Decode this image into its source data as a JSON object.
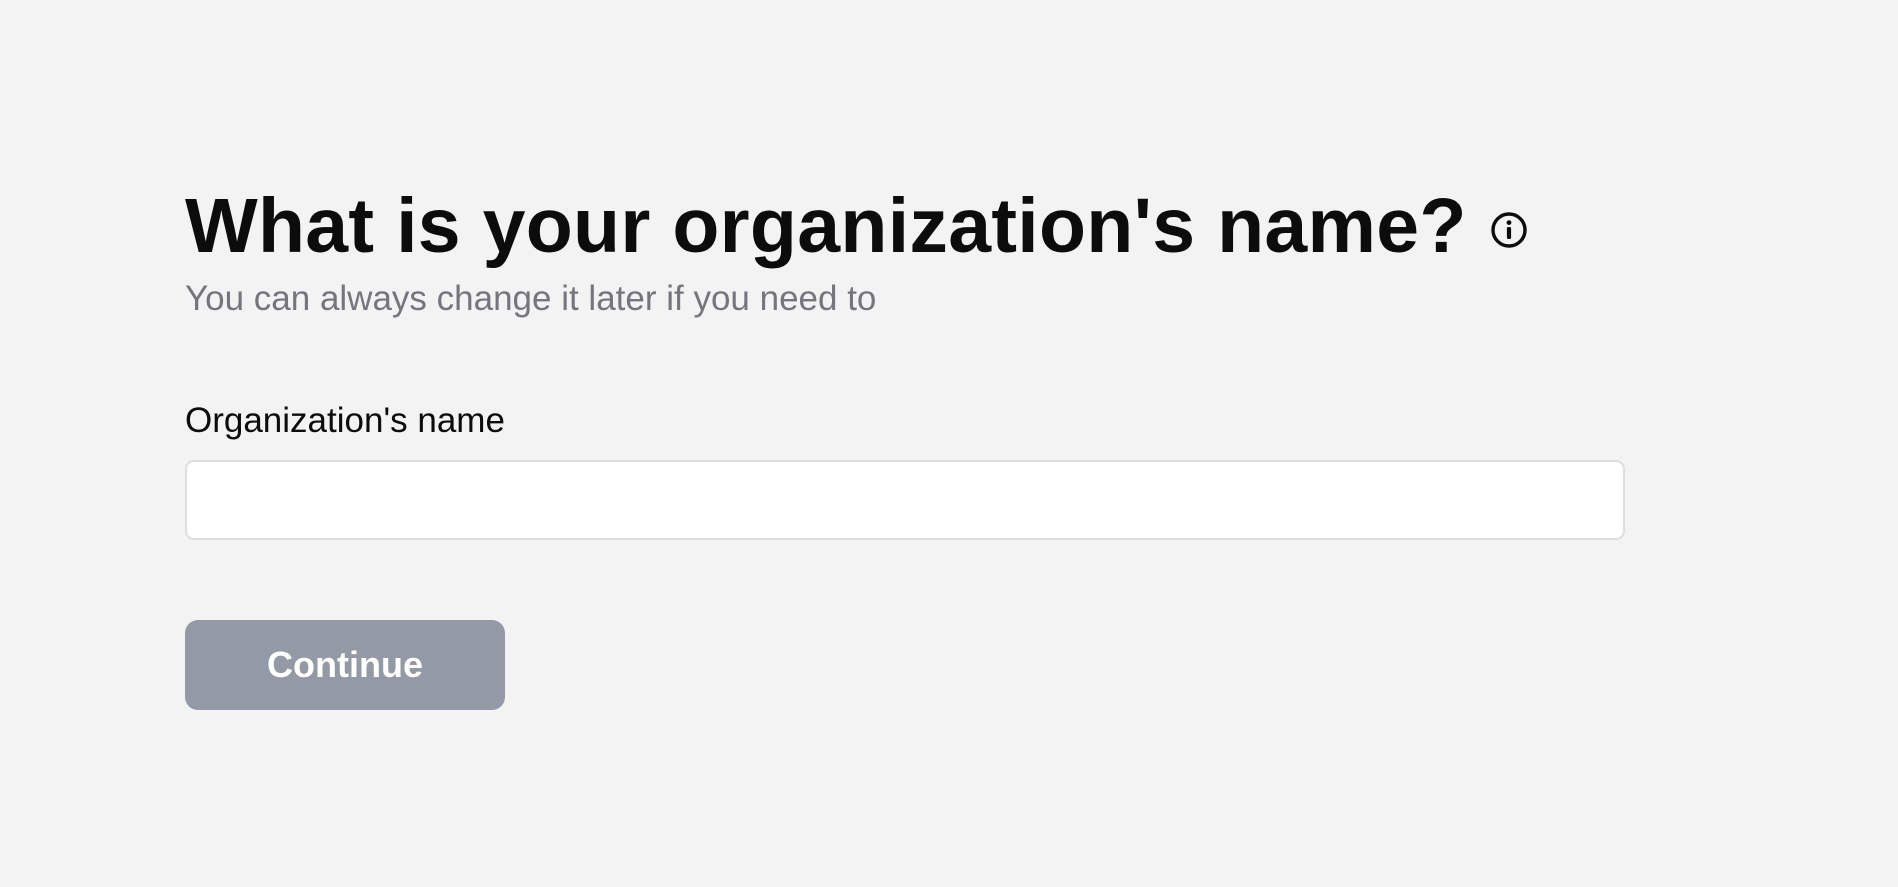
{
  "header": {
    "title": "What is your organization's name?",
    "info_icon": "info-circle-icon",
    "subtitle": "You can always change it later if you need to"
  },
  "form": {
    "org_name_label": "Organization's name",
    "org_name_value": "",
    "org_name_placeholder": "",
    "continue_label": "Continue",
    "continue_enabled": false
  },
  "colors": {
    "background": "#f3f3f3",
    "title_text": "#0c0c0d",
    "subtitle_text": "#75757d",
    "input_border": "#dedee2",
    "button_disabled": "#949aa5",
    "button_text": "#ffffff"
  }
}
